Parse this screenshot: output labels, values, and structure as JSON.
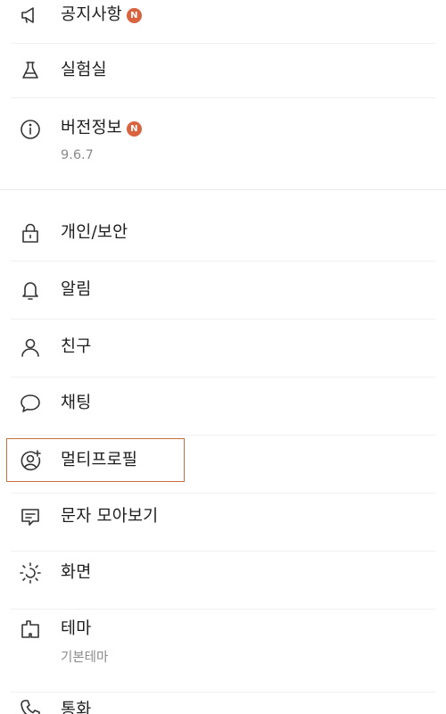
{
  "menu_top": [
    {
      "label": "공지사항",
      "badge": "N",
      "icon": "megaphone-icon"
    },
    {
      "label": "실험실",
      "icon": "flask-icon"
    },
    {
      "label": "버전정보",
      "badge": "N",
      "sub": "9.6.7",
      "icon": "info-icon"
    }
  ],
  "menu_bottom": [
    {
      "label": "개인/보안",
      "icon": "lock-icon"
    },
    {
      "label": "알림",
      "icon": "bell-icon"
    },
    {
      "label": "친구",
      "icon": "person-icon"
    },
    {
      "label": "채팅",
      "icon": "chat-bubble-icon"
    },
    {
      "label": "멀티프로필",
      "icon": "multi-profile-icon",
      "highlighted": true
    },
    {
      "label": "문자 모아보기",
      "icon": "message-collect-icon"
    },
    {
      "label": "화면",
      "icon": "brightness-icon"
    },
    {
      "label": "테마",
      "sub": "기본테마",
      "icon": "theme-icon"
    },
    {
      "label": "통화",
      "icon": "phone-icon"
    }
  ],
  "colors": {
    "badge": "#d9623f",
    "highlight_border": "#c9703f",
    "subtext": "#8b8b8b",
    "text": "#1e1e1e"
  }
}
